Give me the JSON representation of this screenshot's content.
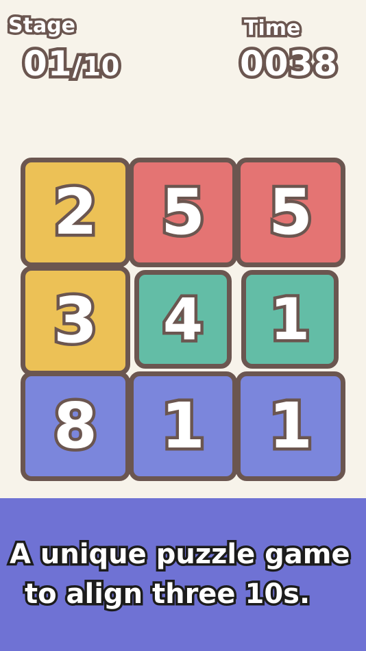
{
  "hud": {
    "stage_label": "Stage",
    "stage_current": "01",
    "stage_total": "/10",
    "time_label": "Time",
    "time_value": "0038"
  },
  "board": {
    "tiles": [
      {
        "value": "2",
        "color": "#ecc156"
      },
      {
        "value": "5",
        "color": "#e47473"
      },
      {
        "value": "5",
        "color": "#e47473"
      },
      {
        "value": "3",
        "color": "#ecc156"
      },
      {
        "value": "4",
        "color": "#63bda6"
      },
      {
        "value": "1",
        "color": "#63bda6"
      },
      {
        "value": "8",
        "color": "#7b86dc"
      },
      {
        "value": "1",
        "color": "#7b86dc"
      },
      {
        "value": "1",
        "color": "#7b86dc"
      }
    ]
  },
  "banner": {
    "line1": "A unique puzzle game",
    "line2": "to align three 10s.",
    "color": "#6f72d4"
  }
}
